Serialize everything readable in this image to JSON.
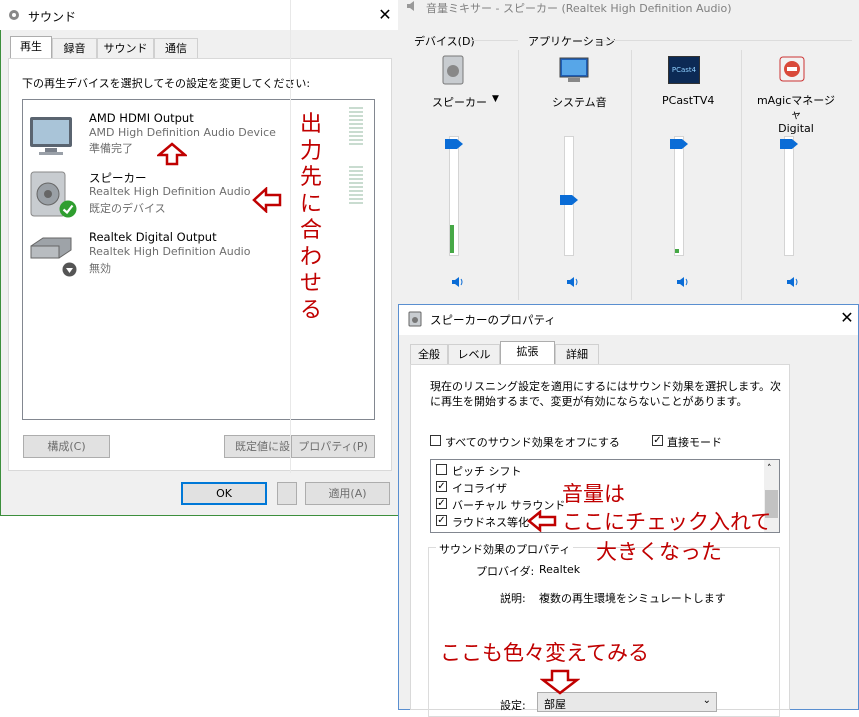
{
  "sound_dialog": {
    "title": "サウンド",
    "close": "✕",
    "tabs": [
      "再生",
      "録音",
      "サウンド",
      "通信"
    ],
    "instruction": "下の再生デバイスを選択してその設定を変更してください:",
    "devices": [
      {
        "name": "AMD HDMI Output",
        "line1": "AMD High Definition Audio Device",
        "line2": "準備完了"
      },
      {
        "name": "スピーカー",
        "line1": "Realtek High Definition Audio",
        "line2": "既定のデバイス"
      },
      {
        "name": "Realtek Digital Output",
        "line1": "Realtek High Definition Audio",
        "line2": "無効"
      }
    ],
    "buttons": {
      "configure": "構成(C)",
      "set_default": "既定値に設",
      "properties": "プロパティ(P)",
      "ok": "OK",
      "apply": "適用(A)"
    }
  },
  "mixer": {
    "title": "音量ミキサー - スピーカー (Realtek High Definition Audio)",
    "device_label": "デバイス(D)",
    "apps_label": "アプリケーション",
    "columns": [
      {
        "name": "スピーカー",
        "dropdown": "▼",
        "level": 0.93
      },
      {
        "name": "システム音",
        "level": 0.47
      },
      {
        "name": "PCastTV4",
        "level": 0.93
      },
      {
        "name": "mAgicマネージャ\nDigital",
        "level": 0.93
      }
    ],
    "pcast_logo": "PCast4"
  },
  "properties": {
    "title": "スピーカーのプロパティ",
    "close": "✕",
    "tabs": [
      "全般",
      "レベル",
      "拡張",
      "詳細"
    ],
    "description": "現在のリスニング設定を適用にするにはサウンド効果を選択します。次に再生を開始するまで、変更が有効にならないことがあります。",
    "disable_all": "すべてのサウンド効果をオフにする",
    "immediate": "直接モード",
    "effects": [
      {
        "label": "ピッチ シフト",
        "checked": false
      },
      {
        "label": "イコライザ",
        "checked": true
      },
      {
        "label": "バーチャル サラウンド",
        "checked": true
      },
      {
        "label": "ラウドネス等化",
        "checked": true
      }
    ],
    "group_title": "サウンド効果のプロパティ",
    "provider_label": "プロバイダ:",
    "provider_value": "Realtek",
    "desc_label": "説明:",
    "desc_value": "複数の再生環境をシミュレートします",
    "setting_label": "設定:",
    "setting_value": "部屋"
  },
  "annotations": {
    "vertical": [
      "出",
      "力",
      "先",
      "に",
      "合",
      "わ",
      "せ",
      "る"
    ],
    "volume_line1": "音量は",
    "volume_line2": "ここにチェック入れて",
    "volume_line3": "大きくなった",
    "change": "ここも色々変えてみる"
  }
}
